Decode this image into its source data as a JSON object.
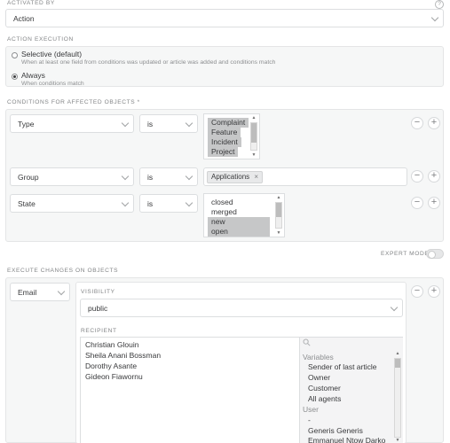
{
  "activated_by": {
    "label": "ACTIVATED BY",
    "help": "?",
    "value": "Action"
  },
  "action_execution": {
    "label": "ACTION EXECUTION",
    "options": [
      {
        "title": "Selective (default)",
        "subtitle": "When at least one field from conditions was updated or article was added and conditions match",
        "checked": false
      },
      {
        "title": "Always",
        "subtitle": "When conditions match",
        "checked": true
      }
    ]
  },
  "conditions": {
    "label": "CONDITIONS FOR AFFECTED OBJECTS *",
    "rows": [
      {
        "attribute": "Type",
        "operator": "is",
        "options": [
          "Complaint",
          "Feature",
          "Incident",
          "Project"
        ]
      },
      {
        "attribute": "Group",
        "operator": "is",
        "token": "Applications",
        "token_remove": "×"
      },
      {
        "attribute": "State",
        "operator": "is",
        "options": [
          "closed",
          "merged",
          "new",
          "open"
        ]
      }
    ],
    "remove_glyph": "−",
    "add_glyph": "+"
  },
  "expert_mode": {
    "label": "EXPERT MODE",
    "enabled": false
  },
  "execute_changes": {
    "label": "EXECUTE CHANGES ON OBJECTS",
    "action": "Email",
    "visibility_label": "VISIBILITY",
    "visibility_value": "public",
    "recipient_label": "RECIPIENT",
    "recipients": [
      "Christian Glouin",
      "Sheila Anani Bossman",
      "Dorothy Asante",
      "Gideon Fiawornu"
    ],
    "list": {
      "variables_header": "Variables",
      "variables": [
        "Sender of last article",
        "Owner",
        "Customer",
        "All agents"
      ],
      "user_header": "User",
      "users": [
        "-",
        "Generis Generis",
        "Emmanuel Ntow Darko"
      ]
    }
  }
}
